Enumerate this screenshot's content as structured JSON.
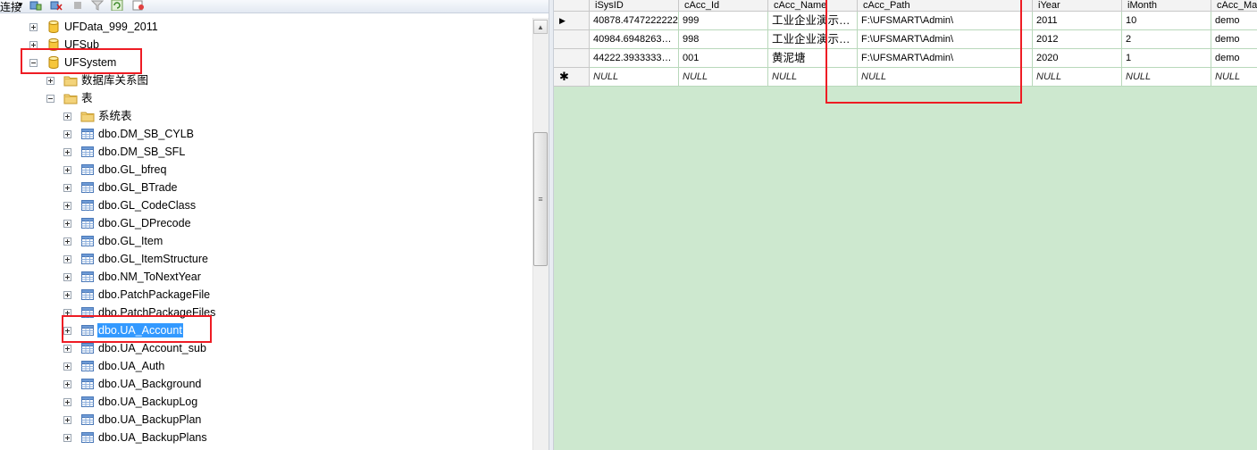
{
  "toolbar": {
    "connect_label": "连接",
    "icons": [
      "connect-icon",
      "disconnect-icon",
      "stop-icon",
      "filter-icon",
      "refresh-icon",
      "summary-icon"
    ]
  },
  "tree": {
    "nodes": [
      {
        "label": "UFData_999_2011",
        "icon": "database-icon",
        "expander": "plus"
      },
      {
        "label": "UFSub",
        "icon": "database-icon",
        "expander": "plus"
      },
      {
        "label": "UFSystem",
        "icon": "database-icon",
        "expander": "minus"
      },
      {
        "label": "数据库关系图",
        "icon": "folder-icon",
        "expander": "plus"
      },
      {
        "label": "表",
        "icon": "folder-icon",
        "expander": "minus"
      },
      {
        "label": "系统表",
        "icon": "folder-icon",
        "expander": "plus"
      },
      {
        "label": "dbo.DM_SB_CYLB",
        "icon": "table-icon",
        "expander": "plus"
      },
      {
        "label": "dbo.DM_SB_SFL",
        "icon": "table-icon",
        "expander": "plus"
      },
      {
        "label": "dbo.GL_bfreq",
        "icon": "table-icon",
        "expander": "plus"
      },
      {
        "label": "dbo.GL_BTrade",
        "icon": "table-icon",
        "expander": "plus"
      },
      {
        "label": "dbo.GL_CodeClass",
        "icon": "table-icon",
        "expander": "plus"
      },
      {
        "label": "dbo.GL_DPrecode",
        "icon": "table-icon",
        "expander": "plus"
      },
      {
        "label": "dbo.GL_Item",
        "icon": "table-icon",
        "expander": "plus"
      },
      {
        "label": "dbo.GL_ItemStructure",
        "icon": "table-icon",
        "expander": "plus"
      },
      {
        "label": "dbo.NM_ToNextYear",
        "icon": "table-icon",
        "expander": "plus"
      },
      {
        "label": "dbo.PatchPackageFile",
        "icon": "table-icon",
        "expander": "plus"
      },
      {
        "label": "dbo.PatchPackageFiles",
        "icon": "table-icon",
        "expander": "plus"
      },
      {
        "label": "dbo.UA_Account",
        "icon": "table-icon",
        "expander": "plus",
        "selected": true
      },
      {
        "label": "dbo.UA_Account_sub",
        "icon": "table-icon",
        "expander": "plus"
      },
      {
        "label": "dbo.UA_Auth",
        "icon": "table-icon",
        "expander": "plus"
      },
      {
        "label": "dbo.UA_Background",
        "icon": "table-icon",
        "expander": "plus"
      },
      {
        "label": "dbo.UA_BackupLog",
        "icon": "table-icon",
        "expander": "plus"
      },
      {
        "label": "dbo.UA_BackupPlan",
        "icon": "table-icon",
        "expander": "plus"
      },
      {
        "label": "dbo.UA_BackupPlans",
        "icon": "table-icon",
        "expander": "plus"
      }
    ]
  },
  "grid": {
    "columns": [
      "iSysID",
      "cAcc_Id",
      "cAcc_Name",
      "cAcc_Path",
      "iYear",
      "iMonth",
      "cAcc_Master"
    ],
    "rows": [
      {
        "marker": "current",
        "cells": [
          "40878.4747222222",
          "999",
          "工业企业演示…",
          "F:\\UFSMART\\Admin\\",
          "2011",
          "10",
          "demo"
        ]
      },
      {
        "marker": "",
        "cells": [
          "40984.6948263…",
          "998",
          "工业企业演示…",
          "F:\\UFSMART\\Admin\\",
          "2012",
          "2",
          "demo"
        ]
      },
      {
        "marker": "",
        "cells": [
          "44222.3933333…",
          "001",
          "黄泥塘",
          "F:\\UFSMART\\Admin\\",
          "2020",
          "1",
          "demo"
        ]
      },
      {
        "marker": "new",
        "cells": [
          "NULL",
          "NULL",
          "NULL",
          "NULL",
          "NULL",
          "NULL",
          "NULL"
        ]
      }
    ]
  },
  "colors": {
    "grid_background": "#cde8cf",
    "selection": "#3399ff",
    "annotation": "#ee1c24"
  }
}
